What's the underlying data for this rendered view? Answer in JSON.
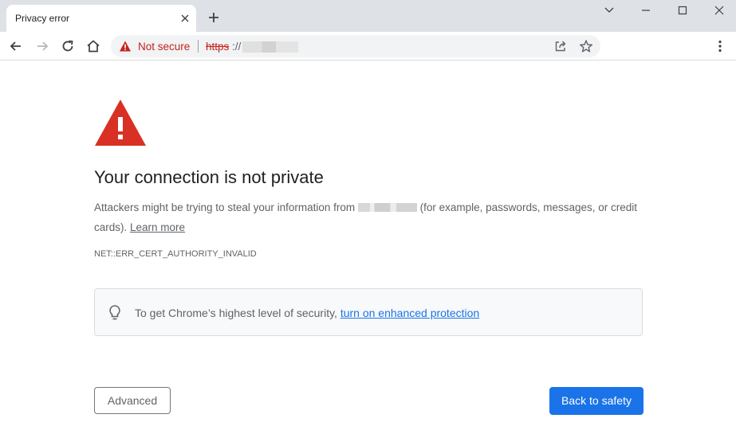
{
  "tab": {
    "title": "Privacy error"
  },
  "omnibox": {
    "security_label": "Not secure",
    "url_scheme": "https",
    "url_separator": "://"
  },
  "page": {
    "heading": "Your connection is not private",
    "body_before_host": "Attackers might be trying to steal your information from ",
    "body_after_host": " (for example, passwords, messages, or credit cards). ",
    "learn_more": "Learn more",
    "error_code": "NET::ERR_CERT_AUTHORITY_INVALID",
    "security_prefix": "To get Chrome’s highest level of security, ",
    "security_link": "turn on enhanced protection",
    "advanced_button": "Advanced",
    "back_button": "Back to safety"
  },
  "icons": {
    "warning": "warning-triangle-icon",
    "lightbulb": "lightbulb-icon",
    "share": "share-icon",
    "star": "bookmark-star-icon"
  },
  "colors": {
    "danger": "#c5221f",
    "warning_triangle": "#d93025",
    "primary": "#1a73e8",
    "tabstrip": "#dee1e6"
  }
}
